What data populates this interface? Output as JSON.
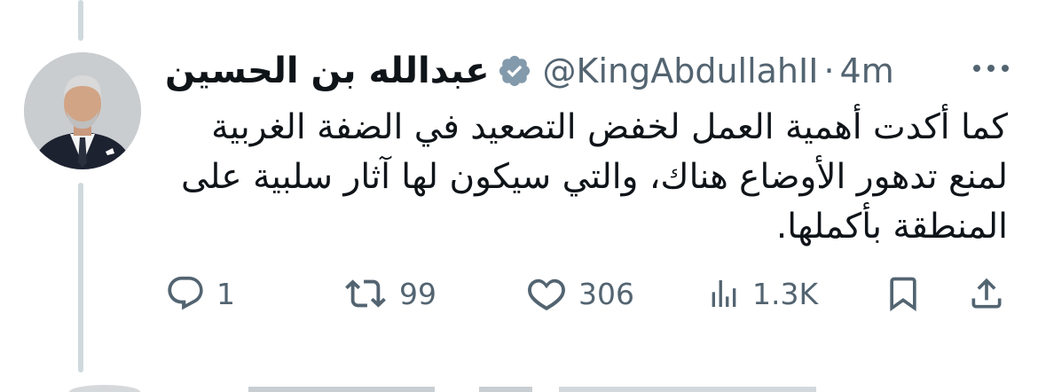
{
  "tweet": {
    "author": {
      "display_name": "عبدالله بن الحسين",
      "handle": "@KingAbdullahII",
      "separator": "·",
      "time": "4m",
      "verified_color": "#829aab"
    },
    "text": "كما أكدت أهمية العمل لخفض التصعيد في الضفة الغربية لمنع تدهور الأوضاع هناك، والتي سيكون لها آثار سلبية على المنطقة بأكملها.",
    "actions": {
      "replies": "1",
      "reposts": "99",
      "likes": "306",
      "views": "1.3K"
    }
  },
  "colors": {
    "text": "#0f1419",
    "secondary": "#536471",
    "thread_line": "#cfd9de"
  },
  "icons": {
    "verified": "verified-badge-icon",
    "more": "more-horizontal-icon",
    "reply": "reply-bubble-icon",
    "repost": "repost-icon",
    "like": "heart-icon",
    "views": "views-bar-chart-icon",
    "bookmark": "bookmark-icon",
    "share": "share-upload-icon"
  }
}
